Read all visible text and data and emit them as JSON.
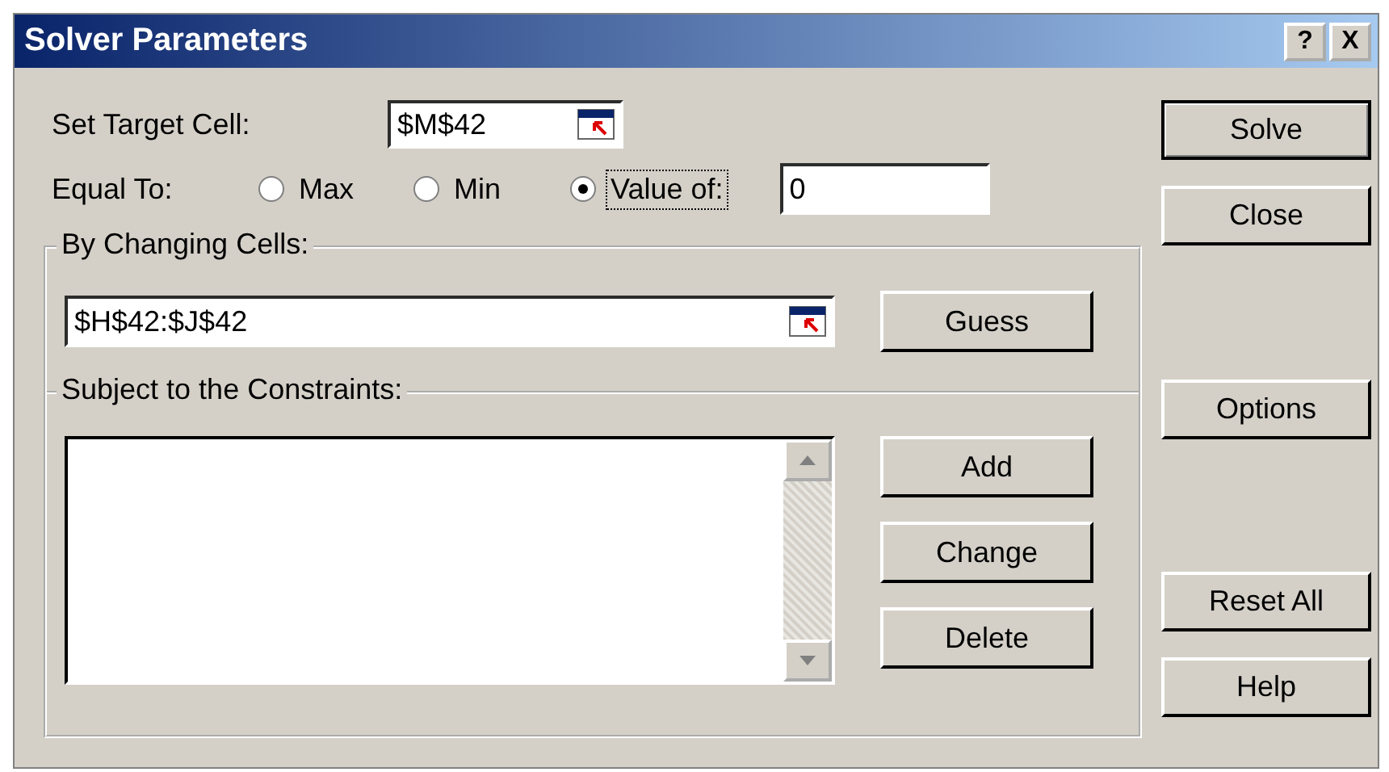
{
  "window": {
    "title": "Solver Parameters",
    "title_buttons": [
      "?",
      "X"
    ]
  },
  "target": {
    "label": "Set Target Cell:",
    "value": "$M$42"
  },
  "equal_to": {
    "label": "Equal To:",
    "options": [
      {
        "label": "Max",
        "selected": false
      },
      {
        "label": "Min",
        "selected": false
      },
      {
        "label": "Value of:",
        "selected": true
      }
    ],
    "value": "0"
  },
  "changing": {
    "title": "By Changing Cells:",
    "value": "$H$42:$J$42",
    "button": "Guess"
  },
  "constraints": {
    "title": "Subject to the Constraints:",
    "buttons": [
      "Add",
      "Change",
      "Delete"
    ]
  },
  "side_buttons": [
    {
      "label": "Solve",
      "default": true
    },
    {
      "label": "Close",
      "default": false
    },
    {
      "label": "Options",
      "default": false
    },
    {
      "label": "Reset All",
      "default": false
    },
    {
      "label": "Help",
      "default": false
    }
  ]
}
